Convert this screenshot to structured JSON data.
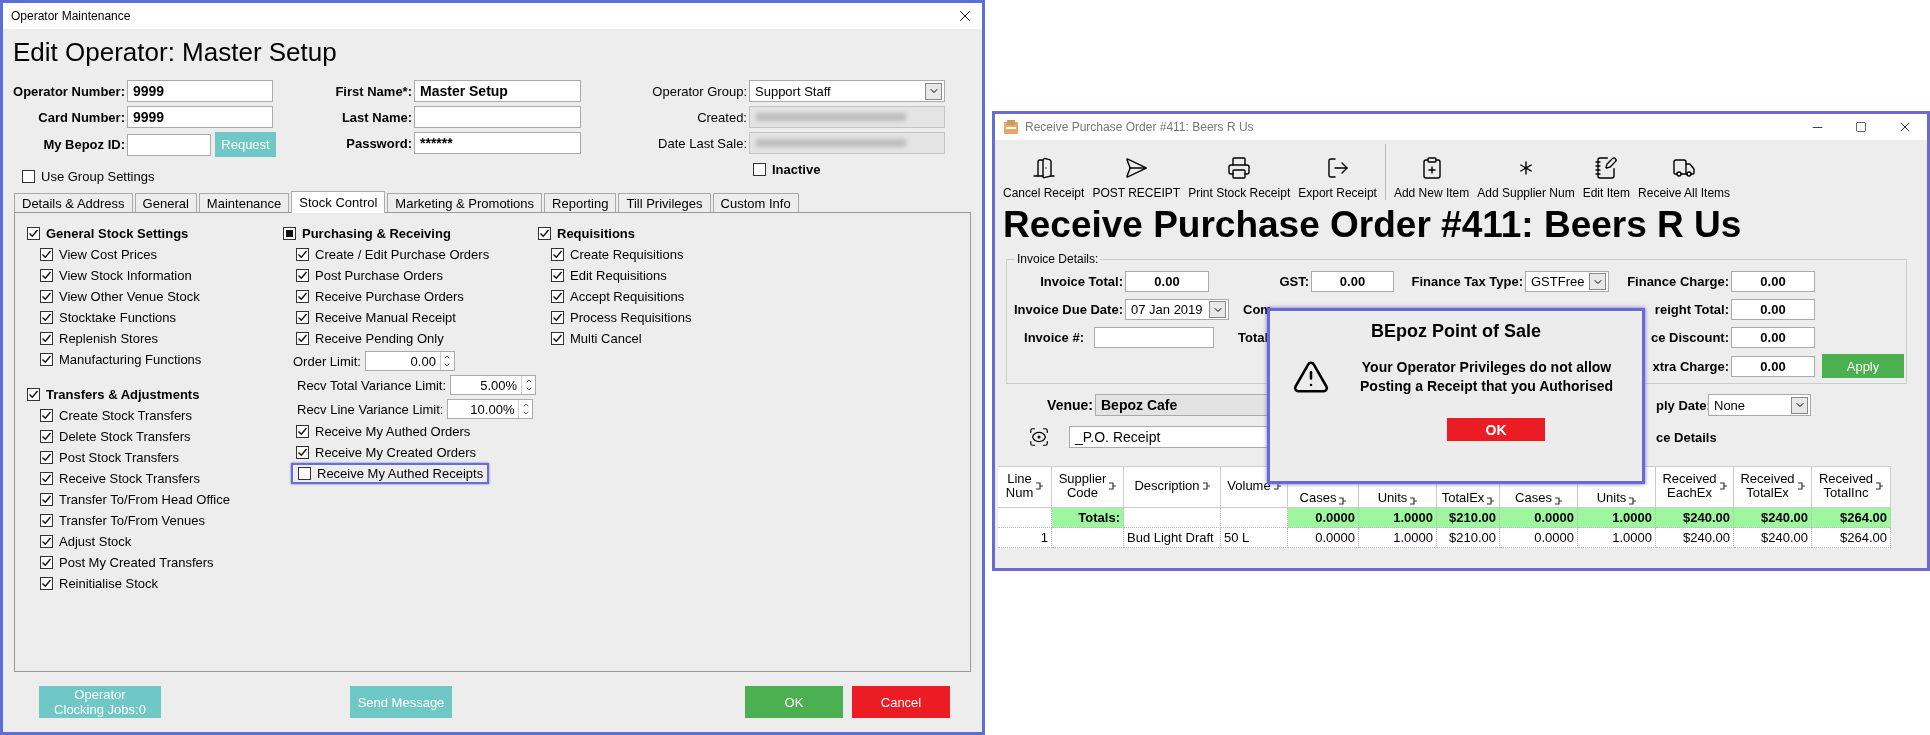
{
  "operator_window": {
    "title": "Operator Maintenance",
    "heading": "Edit Operator: Master Setup",
    "ident_fields": [
      {
        "label": "Operator Number:",
        "value": "9999"
      },
      {
        "label": "Card Number:",
        "value": "9999"
      },
      {
        "label": "My Bepoz ID:",
        "button": "Request"
      }
    ],
    "name_fields": [
      {
        "label": "First Name*:",
        "value": "Master Setup"
      },
      {
        "label": "Last Name:"
      },
      {
        "label": "Password:",
        "value": "******"
      }
    ],
    "info_fields": [
      {
        "kind": "select",
        "label": "Operator Group:",
        "value": "Support Staff"
      },
      {
        "kind": "blurred",
        "label": "Created:"
      },
      {
        "kind": "blurred",
        "label": "Date Last Sale:"
      }
    ],
    "inactive": {
      "label": "Inactive",
      "checked": false
    },
    "use_group_settings": {
      "label": "Use Group Settings",
      "checked": false
    },
    "tabs": [
      {
        "label": "Details & Address",
        "selected": false
      },
      {
        "label": "General",
        "selected": false
      },
      {
        "label": "Maintenance",
        "selected": false
      },
      {
        "label": "Stock Control",
        "selected": true
      },
      {
        "label": "Marketing & Promotions",
        "selected": false
      },
      {
        "label": "Reporting",
        "selected": false
      },
      {
        "label": "Till Privileges",
        "selected": false
      },
      {
        "label": "Custom Info",
        "selected": false
      }
    ],
    "columns": [
      [
        {
          "title": "General Stock Settings",
          "kind": "full",
          "checked": true,
          "items": [
            {
              "kind": "check",
              "label": "View Cost Prices",
              "checked": true,
              "highlighted": false
            },
            {
              "kind": "check",
              "label": "View Stock Information",
              "checked": true,
              "highlighted": false
            },
            {
              "kind": "check",
              "label": "View Other Venue Stock",
              "checked": true,
              "highlighted": false
            },
            {
              "kind": "check",
              "label": "Stocktake Functions",
              "checked": true,
              "highlighted": false
            },
            {
              "kind": "check",
              "label": "Replenish Stores",
              "checked": true,
              "highlighted": false
            },
            {
              "kind": "check",
              "label": "Manufacturing Functions",
              "checked": true,
              "highlighted": false
            }
          ]
        },
        {
          "title": "Transfers & Adjustments",
          "kind": "full",
          "checked": true,
          "items": [
            {
              "kind": "check",
              "label": "Create Stock Transfers",
              "checked": true,
              "highlighted": false
            },
            {
              "kind": "check",
              "label": "Delete Stock Transfers",
              "checked": true,
              "highlighted": false
            },
            {
              "kind": "check",
              "label": "Post Stock Transfers",
              "checked": true,
              "highlighted": false
            },
            {
              "kind": "check",
              "label": "Receive Stock Transfers",
              "checked": true,
              "highlighted": false
            },
            {
              "kind": "check",
              "label": "Transfer To/From Head Office",
              "checked": true,
              "highlighted": false
            },
            {
              "kind": "check",
              "label": "Transfer To/From Venues",
              "checked": true,
              "highlighted": false
            },
            {
              "kind": "check",
              "label": "Adjust Stock",
              "checked": true,
              "highlighted": false
            },
            {
              "kind": "check",
              "label": "Post My Created Transfers",
              "checked": true,
              "highlighted": false
            },
            {
              "kind": "check",
              "label": "Reinitialise Stock",
              "checked": true,
              "highlighted": false
            }
          ]
        }
      ],
      [
        {
          "title": "Purchasing & Receiving",
          "kind": "partial",
          "checked": true,
          "items": [
            {
              "kind": "check",
              "label": "Create / Edit Purchase Orders",
              "checked": true,
              "highlighted": false
            },
            {
              "kind": "check",
              "label": "Post Purchase Orders",
              "checked": true,
              "highlighted": false
            },
            {
              "kind": "check",
              "label": "Receive Purchase Orders",
              "checked": true,
              "highlighted": false
            },
            {
              "kind": "check",
              "label": "Receive Manual Receipt",
              "checked": true,
              "highlighted": false
            },
            {
              "kind": "check",
              "label": "Receive Pending Only",
              "checked": true,
              "highlighted": false
            },
            {
              "kind": "number",
              "label": "Order Limit:",
              "value": "0.00"
            },
            {
              "kind": "number",
              "label": "Recv Total Variance Limit:",
              "value": "5.00%"
            },
            {
              "kind": "number",
              "label": "Recv Line Variance Limit:",
              "value": "10.00%"
            },
            {
              "kind": "check",
              "label": "Receive My Authed Orders",
              "checked": true,
              "highlighted": false
            },
            {
              "kind": "check",
              "label": "Receive My Created Orders",
              "checked": true,
              "highlighted": false
            },
            {
              "kind": "check",
              "label": "Receive My Authed Receipts",
              "checked": false,
              "highlighted": true
            }
          ]
        }
      ],
      [
        {
          "title": "Requisitions",
          "kind": "full",
          "checked": true,
          "items": [
            {
              "kind": "check",
              "label": "Create Requisitions",
              "checked": true,
              "highlighted": false
            },
            {
              "kind": "check",
              "label": "Edit Requisitions",
              "checked": true,
              "highlighted": false
            },
            {
              "kind": "check",
              "label": "Accept Requisitions",
              "checked": true,
              "highlighted": false
            },
            {
              "kind": "check",
              "label": "Process Requisitions",
              "checked": true,
              "highlighted": false
            },
            {
              "kind": "check",
              "label": "Multi Cancel",
              "checked": true,
              "highlighted": false
            }
          ]
        }
      ]
    ],
    "buttons": [
      {
        "kind": "teal",
        "lines": [
          "Operator",
          "Clocking Jobs:0"
        ]
      },
      {
        "kind": "teal",
        "lines": [
          "Send Message"
        ]
      },
      {
        "kind": "ok",
        "lines": [
          "OK"
        ]
      },
      {
        "kind": "cancel",
        "lines": [
          "Cancel"
        ]
      }
    ]
  },
  "receive_window": {
    "title": "Receive Purchase Order #411: Beers R Us",
    "toolbar_groups": [
      [
        "Cancel Receipt",
        "POST RECEIPT",
        "Print Stock Receipt",
        "Export Receipt"
      ],
      [
        "Add New Item",
        "Add Supplier Num",
        "Edit Item",
        "Receive All Items"
      ]
    ],
    "heading": "Receive Purchase Order #411: Beers R Us",
    "invoice_details": {
      "legend": "Invoice Details:",
      "invoice_total": {
        "label": "Invoice Total:",
        "value": "0.00"
      },
      "gst": {
        "label": "GST:",
        "value": "0.00"
      },
      "finance_tax_type": {
        "label": "Finance Tax Type:",
        "value": "GSTFree"
      },
      "finance_charge": {
        "label": "Finance Charge:",
        "value": "0.00"
      },
      "invoice_due_date": {
        "label": "Invoice Due Date:",
        "value": "07 Jan 2019"
      },
      "partial_label_1": "Com",
      "right_field_2": {
        "label": "reight Total:",
        "value": "0.00"
      },
      "invoice_number": {
        "label": "Invoice #:"
      },
      "partial_label_2": "Total",
      "right_field_3": {
        "label": "ce Discount:",
        "value": "0.00"
      },
      "right_field_4": {
        "label": "xtra Charge:",
        "value": "0.00"
      },
      "apply_button": "Apply"
    },
    "venue": {
      "label": "Venue:",
      "value": "Bepoz Cafe"
    },
    "right_select": {
      "label": "ply Date:",
      "value": "None"
    },
    "template_field": {
      "value": "_P.O. Receipt"
    },
    "partial_label_3": "ce Details",
    "table": {
      "columns": [
        {
          "lines": [
            "Line",
            "Num"
          ]
        },
        {
          "lines": [
            "Supplier",
            "Code"
          ]
        },
        {
          "lines": [
            "Description"
          ]
        },
        {
          "lines": [
            "Volume"
          ]
        },
        {
          "lines": [
            "Cases"
          ]
        },
        {
          "lines": [
            "Units"
          ]
        },
        {
          "lines": [
            "TotalEx"
          ]
        },
        {
          "lines": [
            "Cases"
          ]
        },
        {
          "lines": [
            "Units"
          ]
        },
        {
          "lines": [
            "Received",
            "EachEx"
          ]
        },
        {
          "lines": [
            "Received",
            "TotalEx"
          ]
        },
        {
          "lines": [
            "Received",
            "TotalInc"
          ]
        }
      ],
      "totals": {
        "label": "Totals:",
        "values": [
          "0.0000",
          "1.0000",
          "$210.00",
          "0.0000",
          "1.0000",
          "$240.00",
          "$240.00",
          "$264.00"
        ]
      },
      "rows": [
        {
          "cells": [
            "1",
            null,
            "Bud Light Draft",
            "50 L",
            "0.0000",
            "1.0000",
            "$210.00",
            "0.0000",
            "1.0000",
            "$240.00",
            "$240.00",
            "$264.00"
          ]
        }
      ]
    },
    "dialog": {
      "title": "BEpoz Point of Sale",
      "message_lines": [
        "Your Operator Privileges do not allow",
        "Posting a Receipt that you Authorised"
      ],
      "button": "OK"
    }
  }
}
